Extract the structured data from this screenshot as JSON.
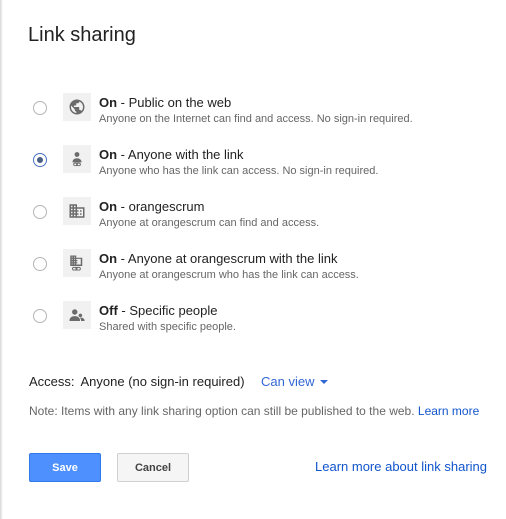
{
  "dialog": {
    "title": "Link sharing"
  },
  "options": [
    {
      "state": "On",
      "label": " - Public on the web",
      "desc": "Anyone on the Internet can find and access. No sign-in required.",
      "icon": "globe-icon",
      "checked": false
    },
    {
      "state": "On",
      "label": " - Anyone with the link",
      "desc": "Anyone who has the link can access. No sign-in required.",
      "icon": "person-link-icon",
      "checked": true
    },
    {
      "state": "On",
      "label": " - orangescrum",
      "desc": "Anyone at orangescrum can find and access.",
      "icon": "building-icon",
      "checked": false
    },
    {
      "state": "On",
      "label": " - Anyone at orangescrum with the link",
      "desc": "Anyone at orangescrum who has the link can access.",
      "icon": "building-link-icon",
      "checked": false
    },
    {
      "state": "Off",
      "label": " - Specific people",
      "desc": "Shared with specific people.",
      "icon": "people-icon",
      "checked": false
    }
  ],
  "access": {
    "label": "Access:",
    "value": "Anyone (no sign-in required)",
    "permission": "Can view"
  },
  "note": {
    "text": "Note: Items with any link sharing option can still be published to the web. ",
    "link": "Learn more"
  },
  "buttons": {
    "save": "Save",
    "cancel": "Cancel"
  },
  "footer": {
    "learn_more_link": "Learn more about link sharing"
  },
  "colors": {
    "primary_button": "#4d90fe",
    "link": "#1155cc",
    "dropdown": "#3367d6"
  }
}
